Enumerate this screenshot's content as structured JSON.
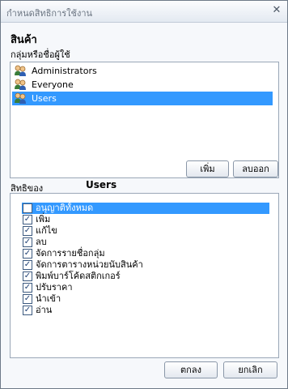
{
  "window": {
    "title": "กำหนดสิทธิการใช้งาน",
    "close_glyph": "✕"
  },
  "heading": "สินค้า",
  "group_label": "กลุ่มหรือชื่อผู้ใช้",
  "groups": [
    {
      "label": "Administrators",
      "icon": "users-icon",
      "selected": false
    },
    {
      "label": "Everyone",
      "icon": "users-icon",
      "selected": false
    },
    {
      "label": "Users",
      "icon": "users-icon",
      "selected": true
    }
  ],
  "buttons": {
    "add": "เพิ่ม",
    "remove": "ลบออก",
    "ok": "ตกลง",
    "cancel": "ยกเลิก"
  },
  "permissions_label": "สิทธิของ",
  "permissions_user": "Users",
  "permissions": [
    {
      "label": "อนุญาติทั้งหมด",
      "checked": false,
      "highlighted": true
    },
    {
      "label": "เพิ่ม",
      "checked": true,
      "highlighted": false
    },
    {
      "label": "แก้ไข",
      "checked": true,
      "highlighted": false
    },
    {
      "label": "ลบ",
      "checked": true,
      "highlighted": false
    },
    {
      "label": "จัดการรายชื่อกลุ่ม",
      "checked": true,
      "highlighted": false
    },
    {
      "label": "จัดการตารางหน่วยนับสินค้า",
      "checked": true,
      "highlighted": false
    },
    {
      "label": "พิมพ์บาร์โค้ดสติกเกอร์",
      "checked": true,
      "highlighted": false
    },
    {
      "label": "ปรับราคา",
      "checked": true,
      "highlighted": false
    },
    {
      "label": "นำเข้า",
      "checked": true,
      "highlighted": false
    },
    {
      "label": "อ่าน",
      "checked": true,
      "highlighted": false
    }
  ],
  "colors": {
    "selection": "#3399ff",
    "border": "#9aa7b7"
  }
}
